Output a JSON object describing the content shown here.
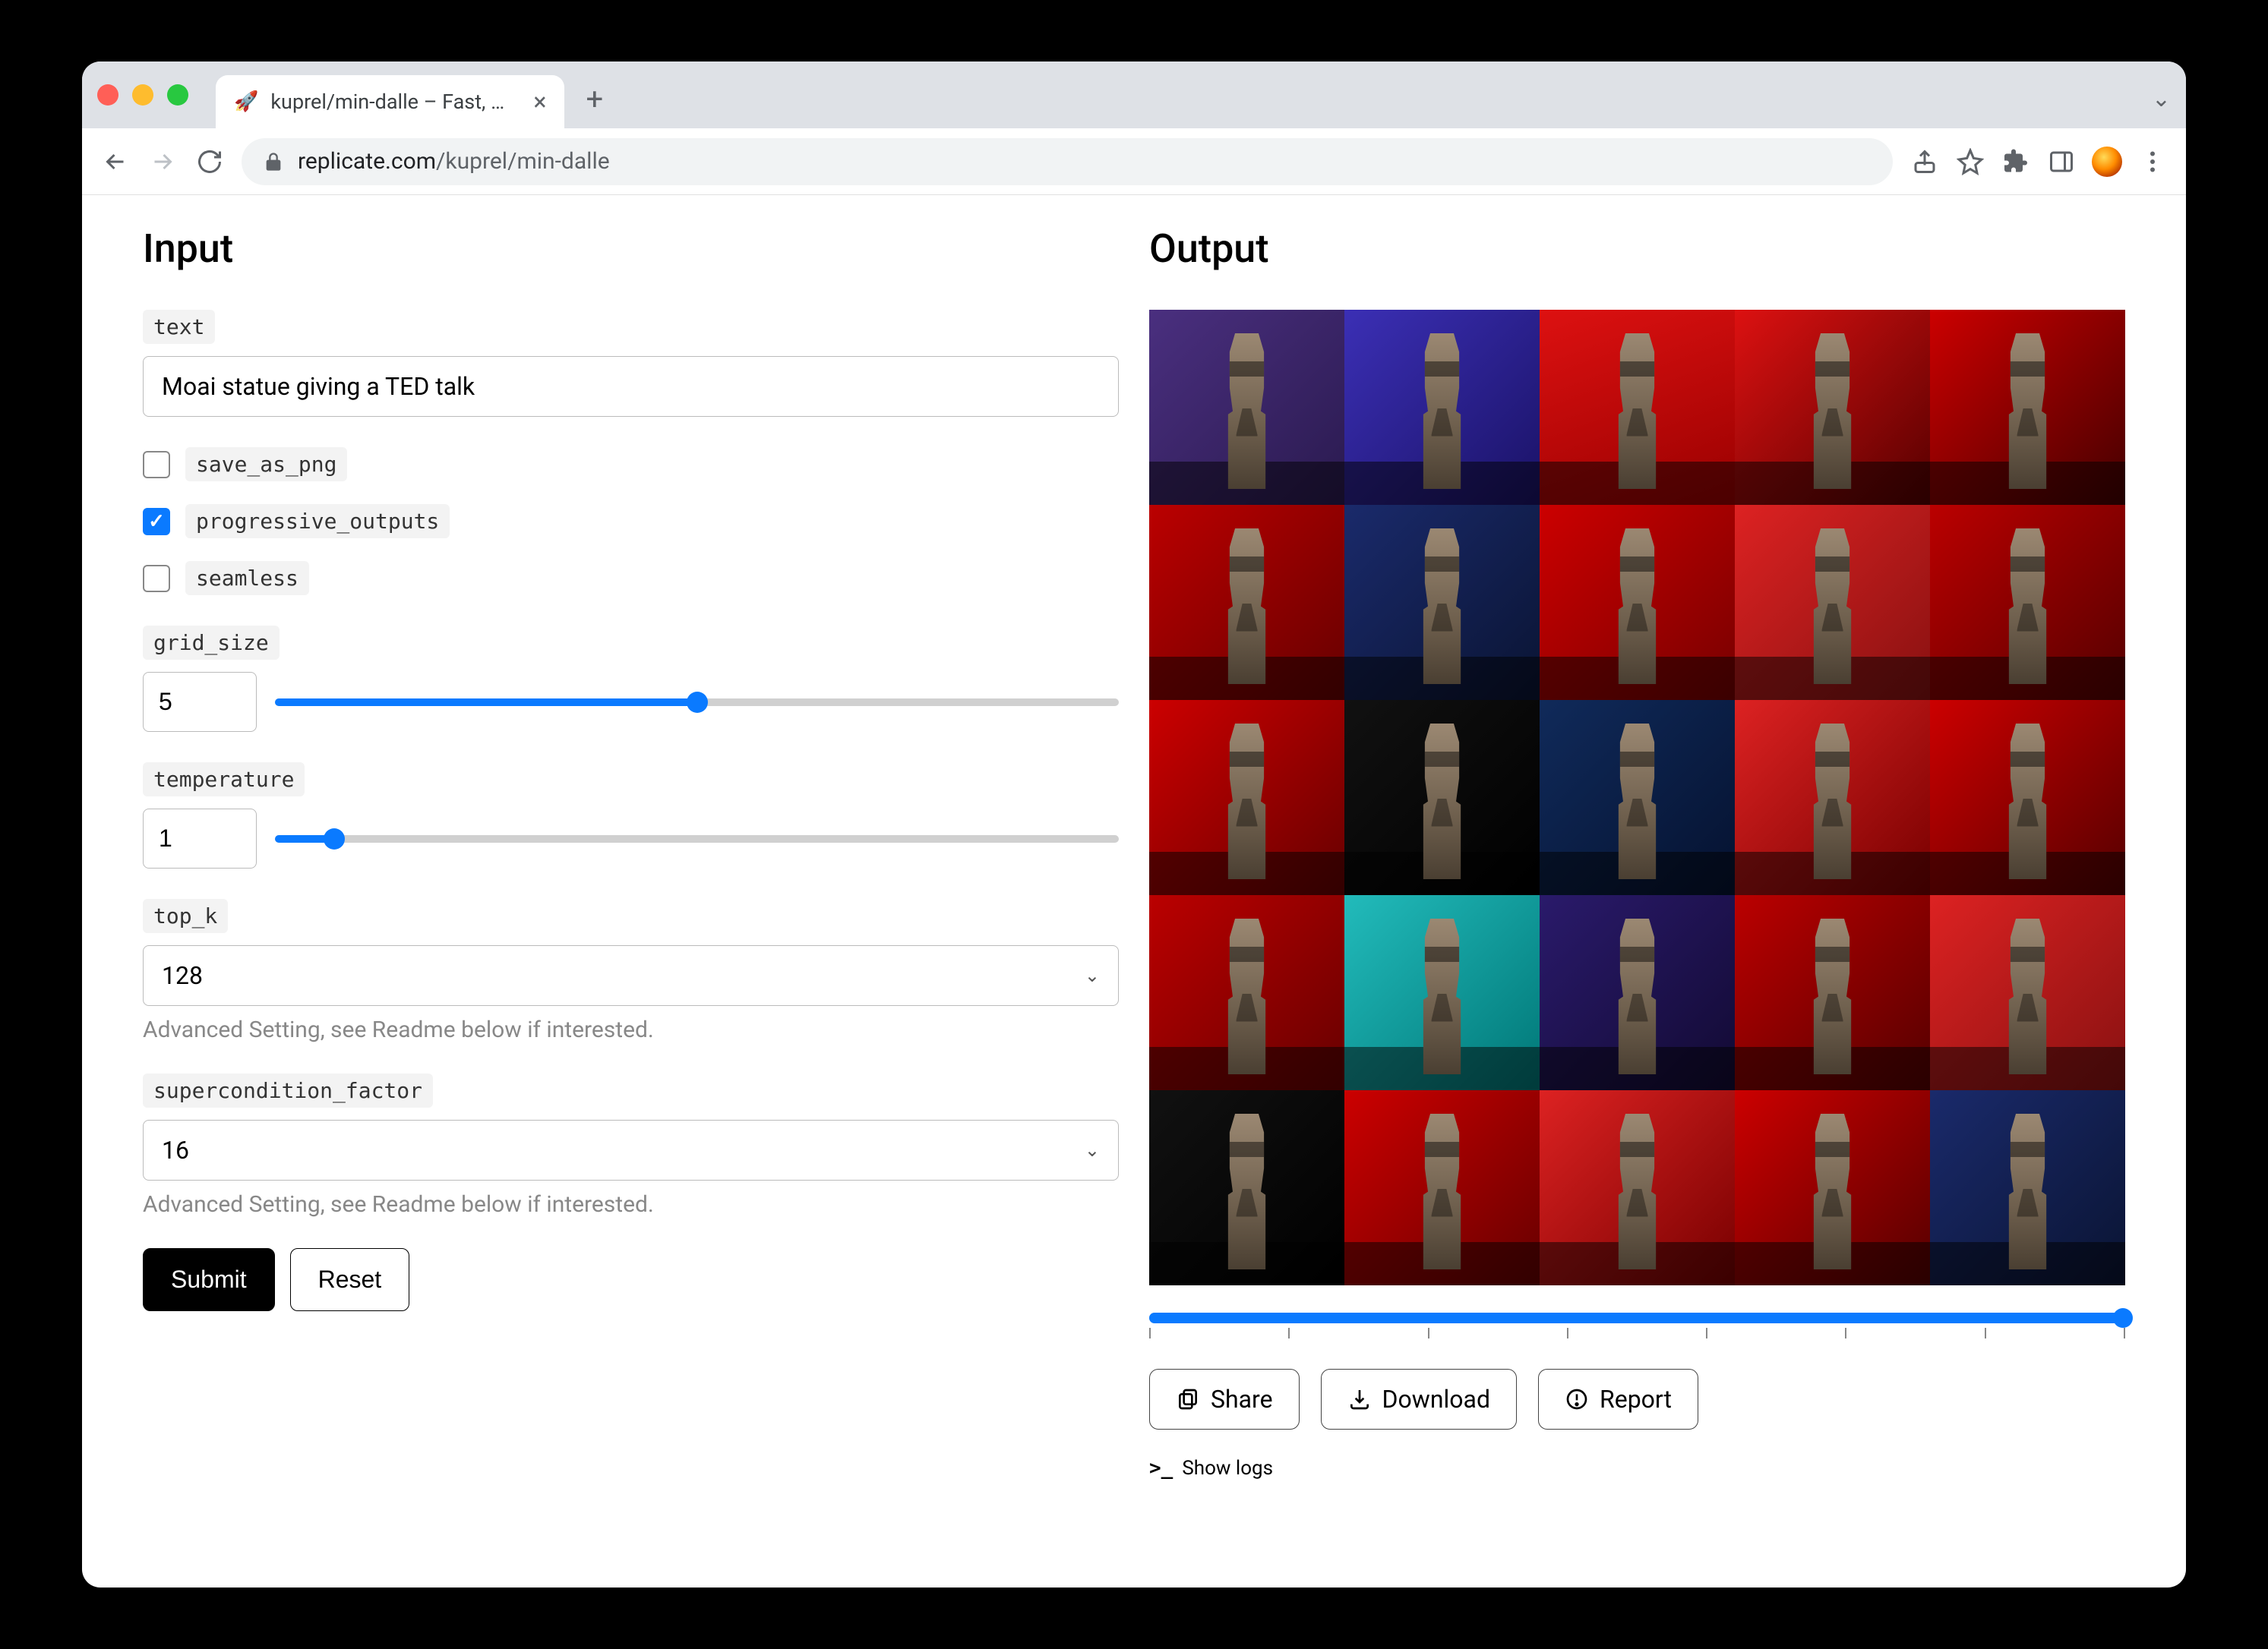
{
  "browser": {
    "tab_title": "kuprel/min-dalle – Fast, minima",
    "url_host": "replicate.com",
    "url_path": "/kuprel/min-dalle"
  },
  "input": {
    "heading": "Input",
    "text_label": "text",
    "text_value": "Moai statue giving a TED talk",
    "save_as_png": {
      "label": "save_as_png",
      "checked": false
    },
    "progressive_outputs": {
      "label": "progressive_outputs",
      "checked": true
    },
    "seamless": {
      "label": "seamless",
      "checked": false
    },
    "grid_size": {
      "label": "grid_size",
      "value": "5",
      "slider_pct": 50
    },
    "temperature": {
      "label": "temperature",
      "value": "1",
      "slider_pct": 7
    },
    "top_k": {
      "label": "top_k",
      "value": "128",
      "helper": "Advanced Setting, see Readme below if interested."
    },
    "supercondition_factor": {
      "label": "supercondition_factor",
      "value": "16",
      "helper": "Advanced Setting, see Readme below if interested."
    },
    "submit_label": "Submit",
    "reset_label": "Reset"
  },
  "output": {
    "heading": "Output",
    "grid_size": 5,
    "tiles": [
      {
        "bg": "linear-gradient(135deg,#4a2f7f,#2a1a4f)"
      },
      {
        "bg": "linear-gradient(135deg,#3b2fb5,#1a1266)"
      },
      {
        "bg": "linear-gradient(160deg,#d11,#900)"
      },
      {
        "bg": "linear-gradient(135deg,#d11,#500)"
      },
      {
        "bg": "linear-gradient(135deg,#c00,#400)"
      },
      {
        "bg": "linear-gradient(135deg,#b00,#600)"
      },
      {
        "bg": "linear-gradient(135deg,#1a2a6b,#0a1433)"
      },
      {
        "bg": "linear-gradient(135deg,#c00,#700)"
      },
      {
        "bg": "linear-gradient(135deg,#d22,#811)"
      },
      {
        "bg": "linear-gradient(135deg,#b00,#500)"
      },
      {
        "bg": "linear-gradient(135deg,#c00,#600)"
      },
      {
        "bg": "linear-gradient(135deg,#111,#000)"
      },
      {
        "bg": "linear-gradient(135deg,#102a5a,#051230)"
      },
      {
        "bg": "linear-gradient(135deg,#d22,#700)"
      },
      {
        "bg": "linear-gradient(135deg,#c00,#500)"
      },
      {
        "bg": "linear-gradient(135deg,#b00,#600)"
      },
      {
        "bg": "linear-gradient(135deg,#2bb,#077)"
      },
      {
        "bg": "linear-gradient(135deg,#2a1a6b,#120a33)"
      },
      {
        "bg": "linear-gradient(135deg,#b00,#500)"
      },
      {
        "bg": "linear-gradient(135deg,#d22,#811)"
      },
      {
        "bg": "linear-gradient(135deg,#111,#000)"
      },
      {
        "bg": "linear-gradient(135deg,#c00,#600)"
      },
      {
        "bg": "linear-gradient(135deg,#d22,#700)"
      },
      {
        "bg": "linear-gradient(135deg,#c00,#500)"
      },
      {
        "bg": "linear-gradient(135deg,#1a2a6b,#0a1433)"
      }
    ],
    "progress_pct": 100,
    "tick_count": 8,
    "share_label": "Share",
    "download_label": "Download",
    "report_label": "Report",
    "show_logs_label": "Show logs"
  }
}
